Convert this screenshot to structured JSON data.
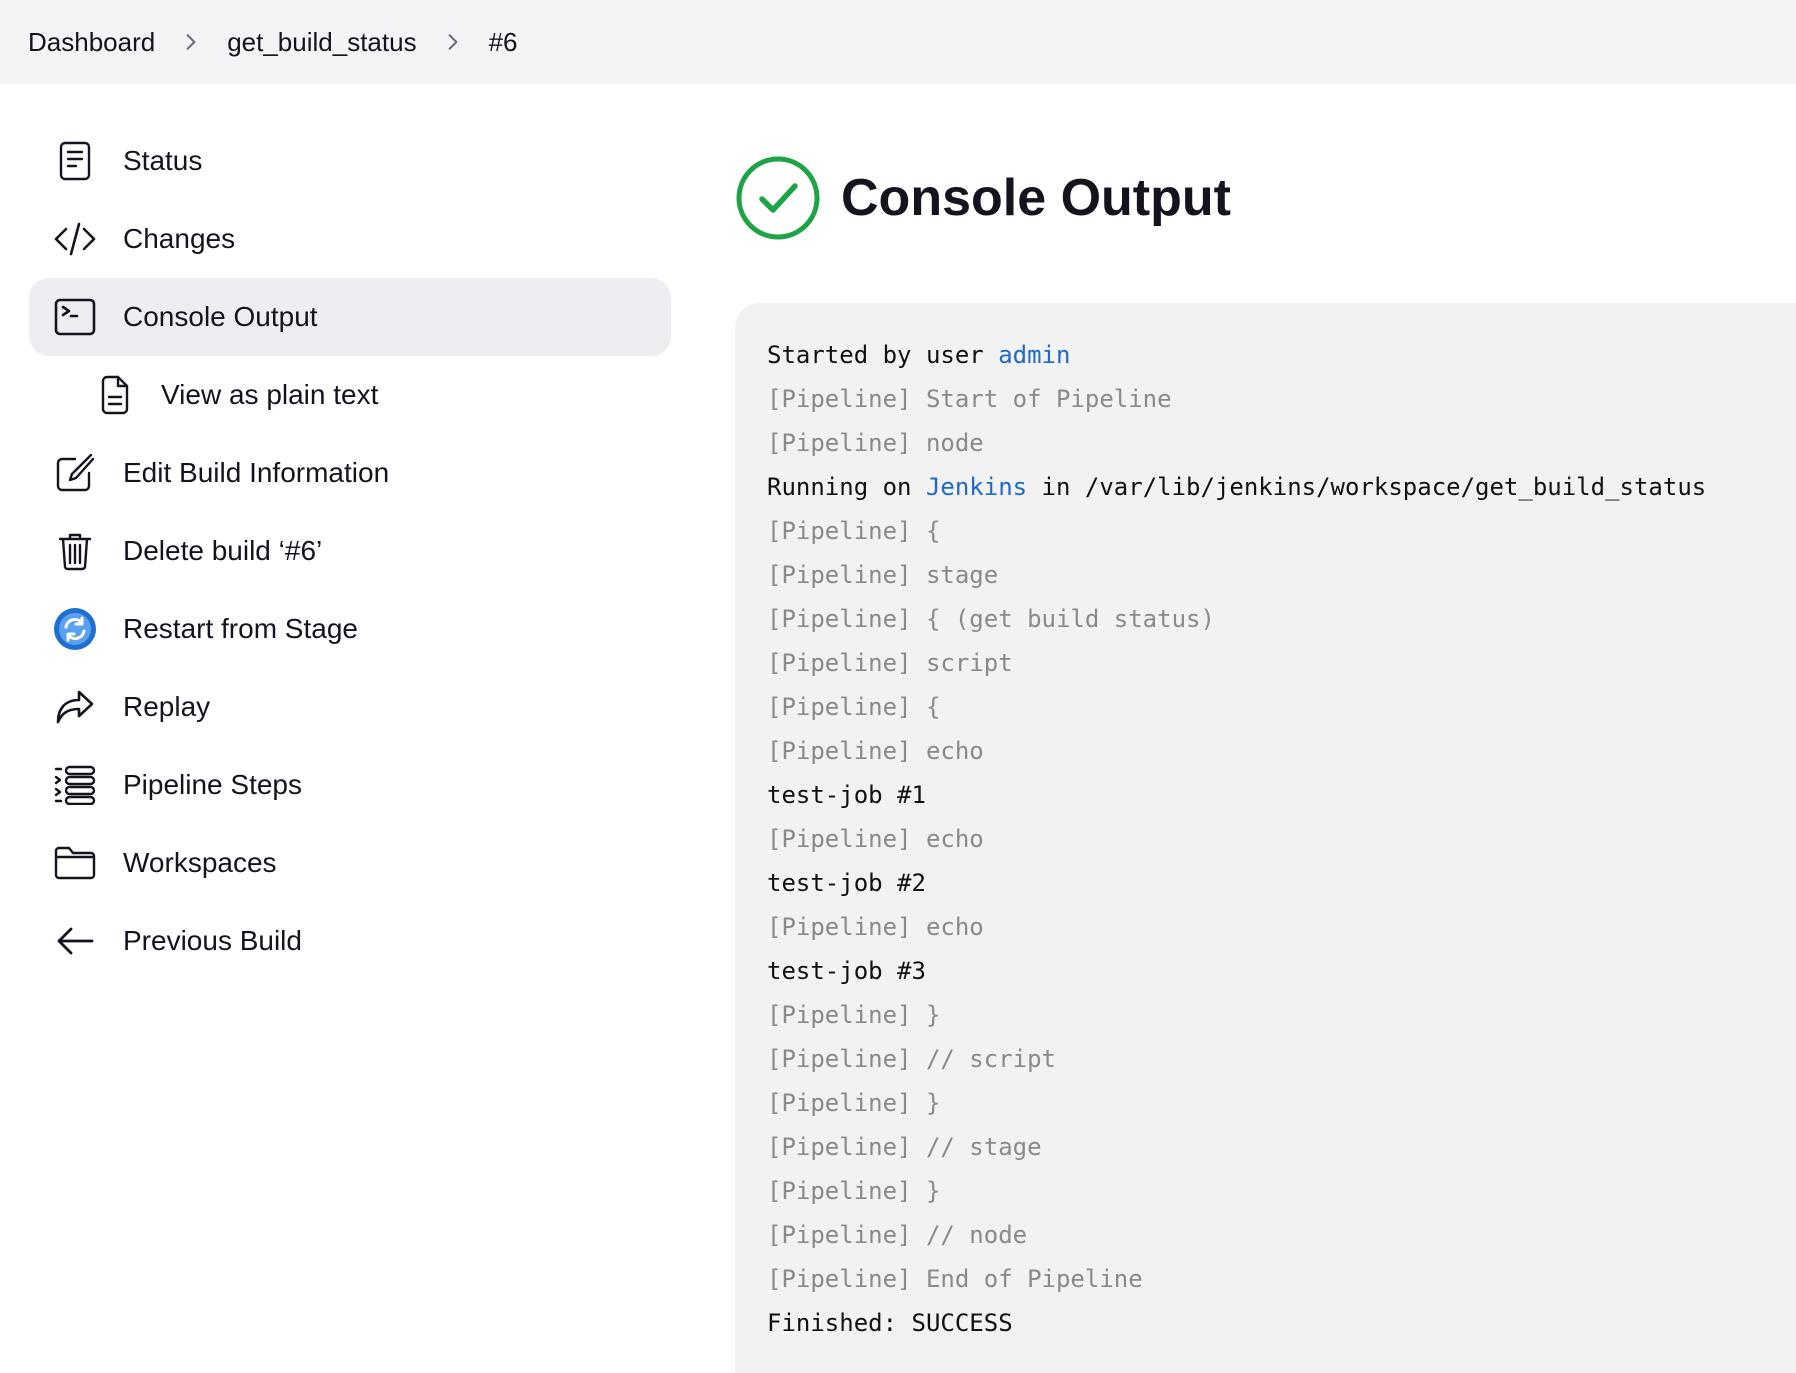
{
  "breadcrumb": {
    "items": [
      "Dashboard",
      "get_build_status",
      "#6"
    ]
  },
  "sidebar": {
    "items": [
      {
        "label": "Status",
        "icon": "document-icon"
      },
      {
        "label": "Changes",
        "icon": "code-icon"
      },
      {
        "label": "Console Output",
        "icon": "terminal-icon",
        "active": true
      },
      {
        "label": "View as plain text",
        "icon": "file-text-icon"
      },
      {
        "label": "Edit Build Information",
        "icon": "edit-icon"
      },
      {
        "label": "Delete build ‘#6’",
        "icon": "trash-icon"
      },
      {
        "label": "Restart from Stage",
        "icon": "restart-icon"
      },
      {
        "label": "Replay",
        "icon": "share-arrow-icon"
      },
      {
        "label": "Pipeline Steps",
        "icon": "list-icon"
      },
      {
        "label": "Workspaces",
        "icon": "folder-icon"
      },
      {
        "label": "Previous Build",
        "icon": "arrow-left-icon"
      }
    ]
  },
  "main": {
    "title": "Console Output",
    "status_color": "#1ea446"
  },
  "console": {
    "lines": [
      {
        "segments": [
          {
            "text": "Started by user ",
            "style": "txt"
          },
          {
            "text": "admin",
            "style": "link"
          }
        ]
      },
      {
        "segments": [
          {
            "text": "[Pipeline] Start of Pipeline",
            "style": "dim"
          }
        ]
      },
      {
        "segments": [
          {
            "text": "[Pipeline] node",
            "style": "dim"
          }
        ]
      },
      {
        "segments": [
          {
            "text": "Running on ",
            "style": "txt"
          },
          {
            "text": "Jenkins",
            "style": "link"
          },
          {
            "text": " in /var/lib/jenkins/workspace/get_build_status",
            "style": "txt"
          }
        ]
      },
      {
        "segments": [
          {
            "text": "[Pipeline] {",
            "style": "dim"
          }
        ]
      },
      {
        "segments": [
          {
            "text": "[Pipeline] stage",
            "style": "dim"
          }
        ]
      },
      {
        "segments": [
          {
            "text": "[Pipeline] { (get build status)",
            "style": "dim"
          }
        ]
      },
      {
        "segments": [
          {
            "text": "[Pipeline] script",
            "style": "dim"
          }
        ]
      },
      {
        "segments": [
          {
            "text": "[Pipeline] {",
            "style": "dim"
          }
        ]
      },
      {
        "segments": [
          {
            "text": "[Pipeline] echo",
            "style": "dim"
          }
        ]
      },
      {
        "segments": [
          {
            "text": "test-job #1",
            "style": "txt"
          }
        ]
      },
      {
        "segments": [
          {
            "text": "[Pipeline] echo",
            "style": "dim"
          }
        ]
      },
      {
        "segments": [
          {
            "text": "test-job #2",
            "style": "txt"
          }
        ]
      },
      {
        "segments": [
          {
            "text": "[Pipeline] echo",
            "style": "dim"
          }
        ]
      },
      {
        "segments": [
          {
            "text": "test-job #3",
            "style": "txt"
          }
        ]
      },
      {
        "segments": [
          {
            "text": "[Pipeline] }",
            "style": "dim"
          }
        ]
      },
      {
        "segments": [
          {
            "text": "[Pipeline] // script",
            "style": "dim"
          }
        ]
      },
      {
        "segments": [
          {
            "text": "[Pipeline] }",
            "style": "dim"
          }
        ]
      },
      {
        "segments": [
          {
            "text": "[Pipeline] // stage",
            "style": "dim"
          }
        ]
      },
      {
        "segments": [
          {
            "text": "[Pipeline] }",
            "style": "dim"
          }
        ]
      },
      {
        "segments": [
          {
            "text": "[Pipeline] // node",
            "style": "dim"
          }
        ]
      },
      {
        "segments": [
          {
            "text": "[Pipeline] End of Pipeline",
            "style": "dim"
          }
        ]
      },
      {
        "segments": [
          {
            "text": "Finished: SUCCESS",
            "style": "txt"
          }
        ]
      }
    ]
  }
}
